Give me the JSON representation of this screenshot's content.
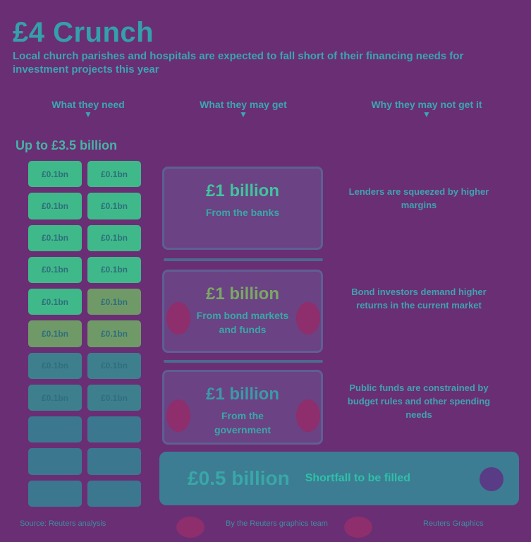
{
  "header": {
    "title": "£4 Crunch",
    "subtitle": "Local church parishes and hospitals are expected to fall short of their financing needs for investment projects this year"
  },
  "columns": [
    {
      "label": "What they need"
    },
    {
      "label": "What they may get"
    },
    {
      "label": "Why they may not get it"
    }
  ],
  "goal": "Up to £3.5 billion",
  "grid": {
    "cells": [
      "£0.1bn",
      "£0.1bn",
      "£0.1bn",
      "£0.1bn",
      "£0.1bn",
      "£0.1bn",
      "£0.1bn",
      "£0.1bn",
      "£0.1bn",
      "£0.1bn",
      "£0.1bn",
      "£0.1bn",
      "£0.1bn",
      "£0.1bn",
      "£0.1bn",
      "£0.1bn",
      "",
      "",
      "",
      "",
      "",
      ""
    ]
  },
  "panels": [
    {
      "amount": "£1 billion",
      "from": "From the banks",
      "side": "Lenders are squeezed by higher margins"
    },
    {
      "amount": "£1 billion",
      "from": "From bond markets and funds",
      "side": "Bond investors demand higher returns in the current market"
    },
    {
      "amount": "£1 billion",
      "from": "From the government",
      "side": "Public funds are constrained by budget rules and other spending needs"
    }
  ],
  "banner": {
    "amount": "£0.5 billion",
    "note": "Shortfall to be filled"
  },
  "footer": {
    "left": "Source: Reuters analysis",
    "center": "By the Reuters graphics team",
    "right": "Reuters Graphics"
  },
  "colors": {
    "background": "#6a2e74",
    "accent": "#34a0aa",
    "highlight": "#3fb98a"
  }
}
